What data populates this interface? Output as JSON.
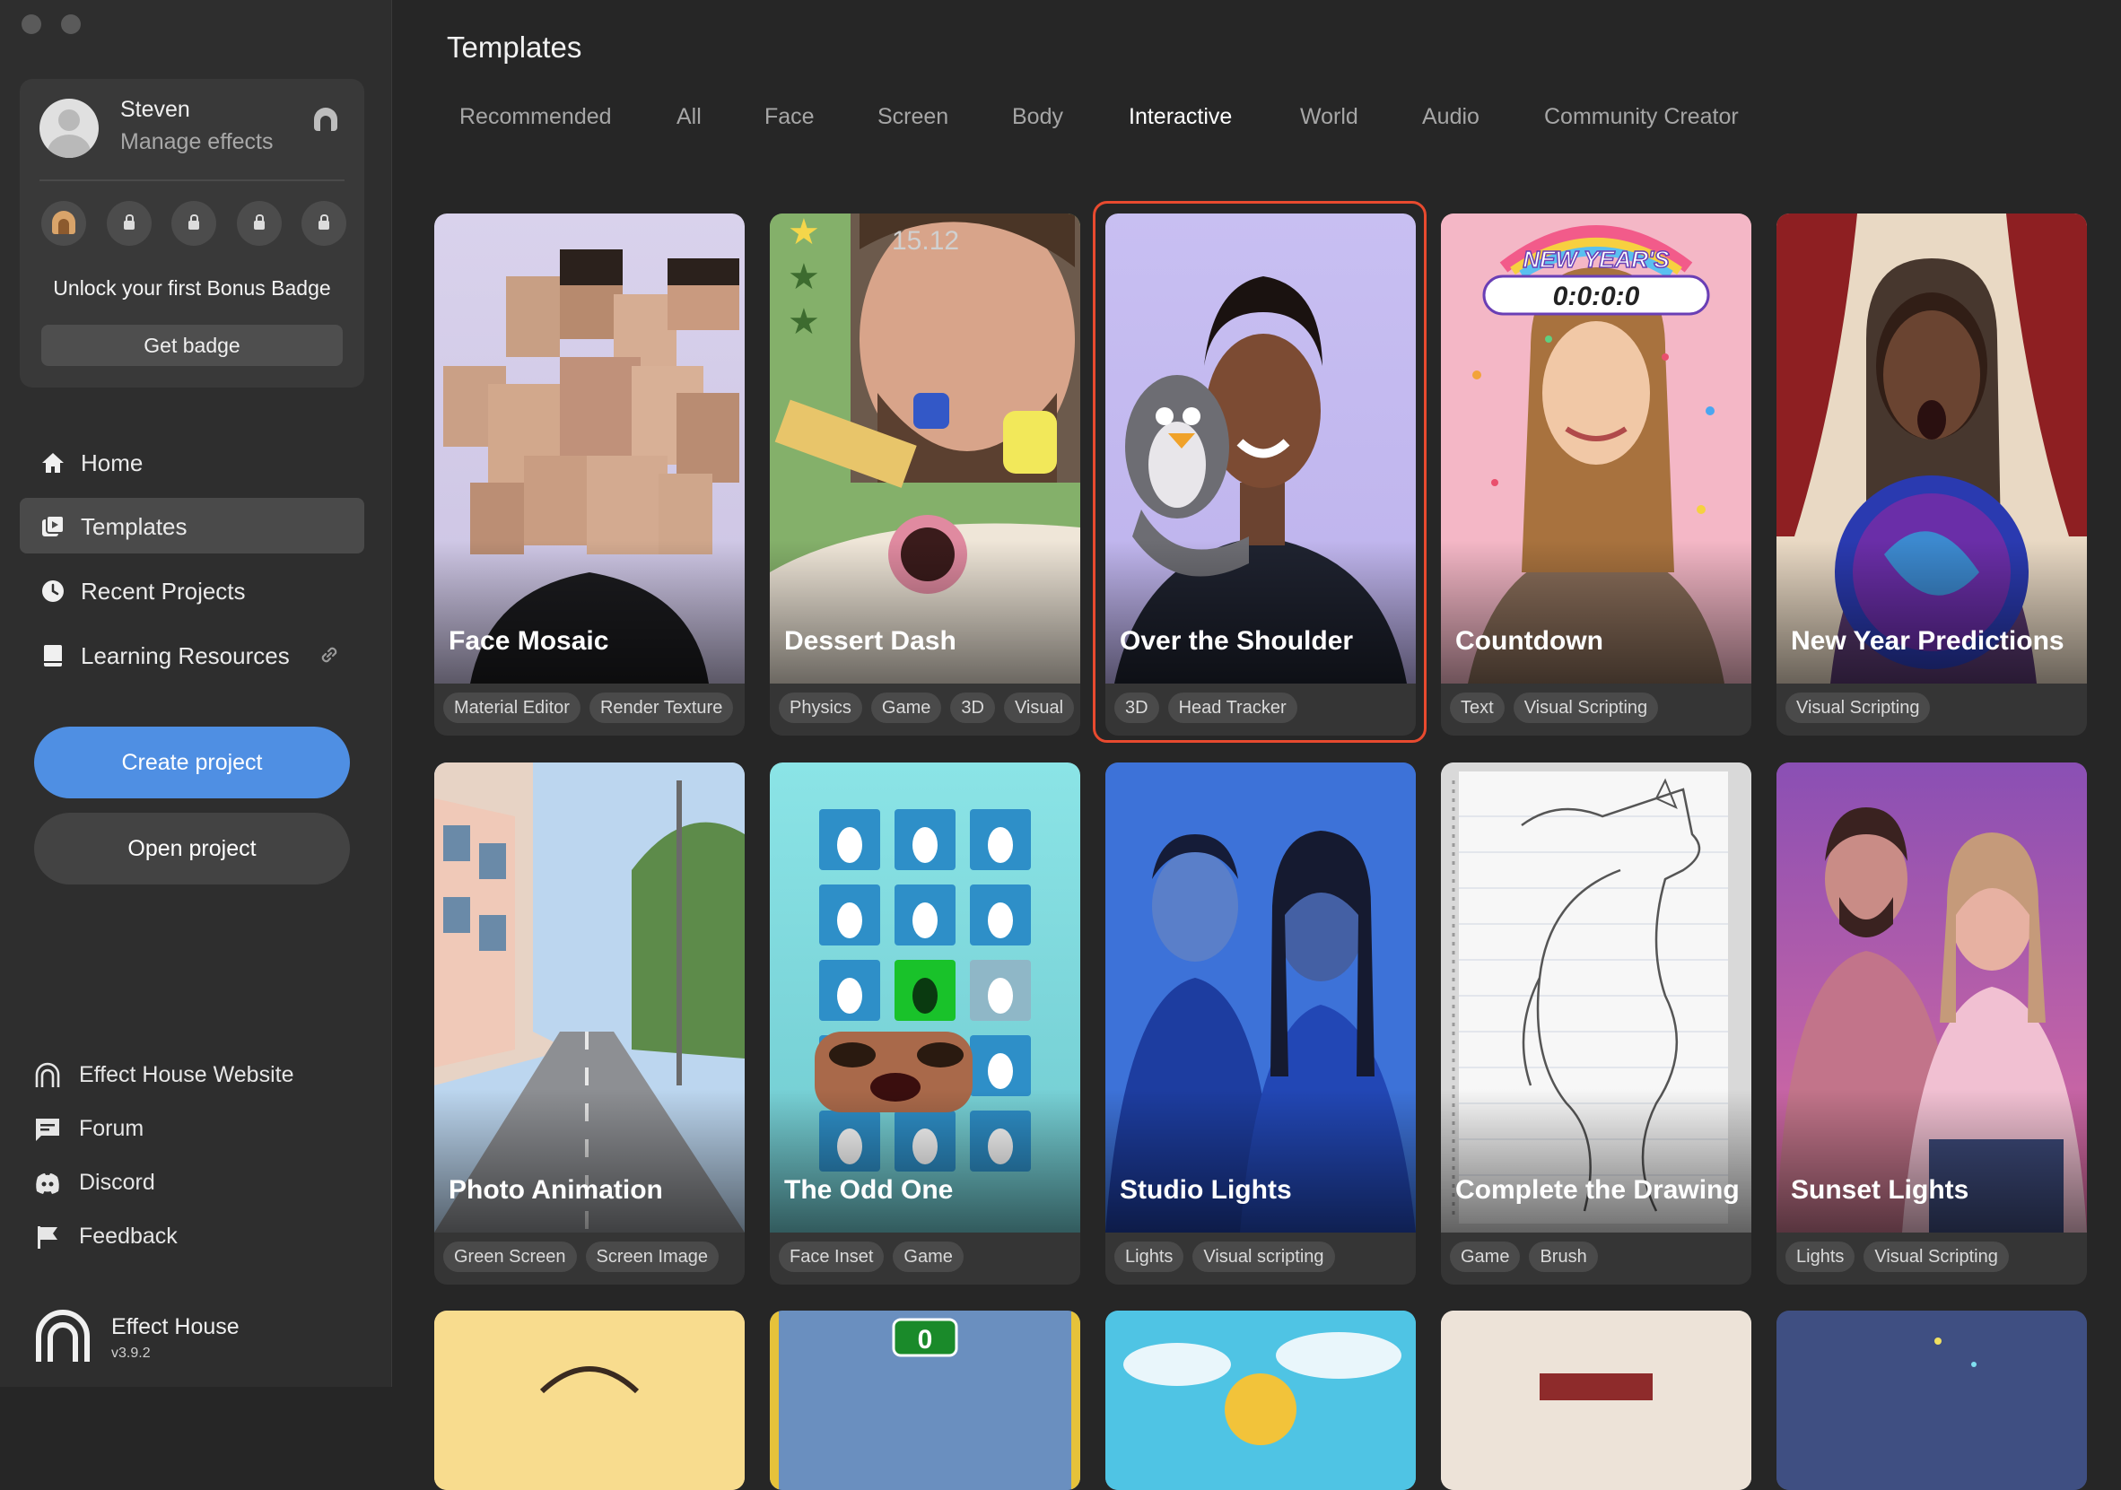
{
  "sidebar": {
    "profile": {
      "name": "Steven",
      "subtitle": "Manage effects",
      "unlock_text": "Unlock your first Bonus Badge",
      "get_badge_label": "Get badge"
    },
    "nav": [
      {
        "label": "Home",
        "icon": "home-icon"
      },
      {
        "label": "Templates",
        "icon": "templates-icon",
        "active": true
      },
      {
        "label": "Recent Projects",
        "icon": "clock-icon"
      },
      {
        "label": "Learning Resources",
        "icon": "book-icon"
      }
    ],
    "create_label": "Create project",
    "open_label": "Open project",
    "footer": [
      {
        "label": "Effect House Website",
        "icon": "effect-house-icon"
      },
      {
        "label": "Forum",
        "icon": "forum-icon"
      },
      {
        "label": "Discord",
        "icon": "discord-icon"
      },
      {
        "label": "Feedback",
        "icon": "flag-icon"
      }
    ],
    "app": {
      "name": "Effect House",
      "version": "v3.9.2"
    }
  },
  "main": {
    "title": "Templates",
    "tabs": [
      "Recommended",
      "All",
      "Face",
      "Screen",
      "Body",
      "Interactive",
      "World",
      "Audio",
      "Community Creator"
    ],
    "active_tab": "Interactive",
    "cards": [
      {
        "title": "Face Mosaic",
        "tags": [
          "Material Editor",
          "Render Texture"
        ]
      },
      {
        "title": "Dessert Dash",
        "tags": [
          "Physics",
          "Game",
          "3D",
          "Visual"
        ],
        "overlay_time": "15.12"
      },
      {
        "title": "Over the Shoulder",
        "tags": [
          "3D",
          "Head Tracker"
        ],
        "selected": true
      },
      {
        "title": "Countdown",
        "tags": [
          "Text",
          "Visual Scripting"
        ],
        "overlay_banner": "NEW YEAR'S",
        "overlay_timer": "0:0:0:0"
      },
      {
        "title": "New Year Predictions",
        "tags": [
          "Visual Scripting"
        ]
      },
      {
        "title": "Photo Animation",
        "tags": [
          "Green Screen",
          "Screen Image"
        ]
      },
      {
        "title": "The Odd One",
        "tags": [
          "Face Inset",
          "Game"
        ]
      },
      {
        "title": "Studio Lights",
        "tags": [
          "Lights",
          "Visual scripting"
        ]
      },
      {
        "title": "Complete the Drawing",
        "tags": [
          "Game",
          "Brush"
        ]
      },
      {
        "title": "Sunset Lights",
        "tags": [
          "Lights",
          "Visual Scripting"
        ]
      }
    ],
    "partial_row": {
      "score": "0"
    },
    "colors": {
      "accent": "#4f8fe3",
      "selected_border": "#e84a2f"
    }
  }
}
